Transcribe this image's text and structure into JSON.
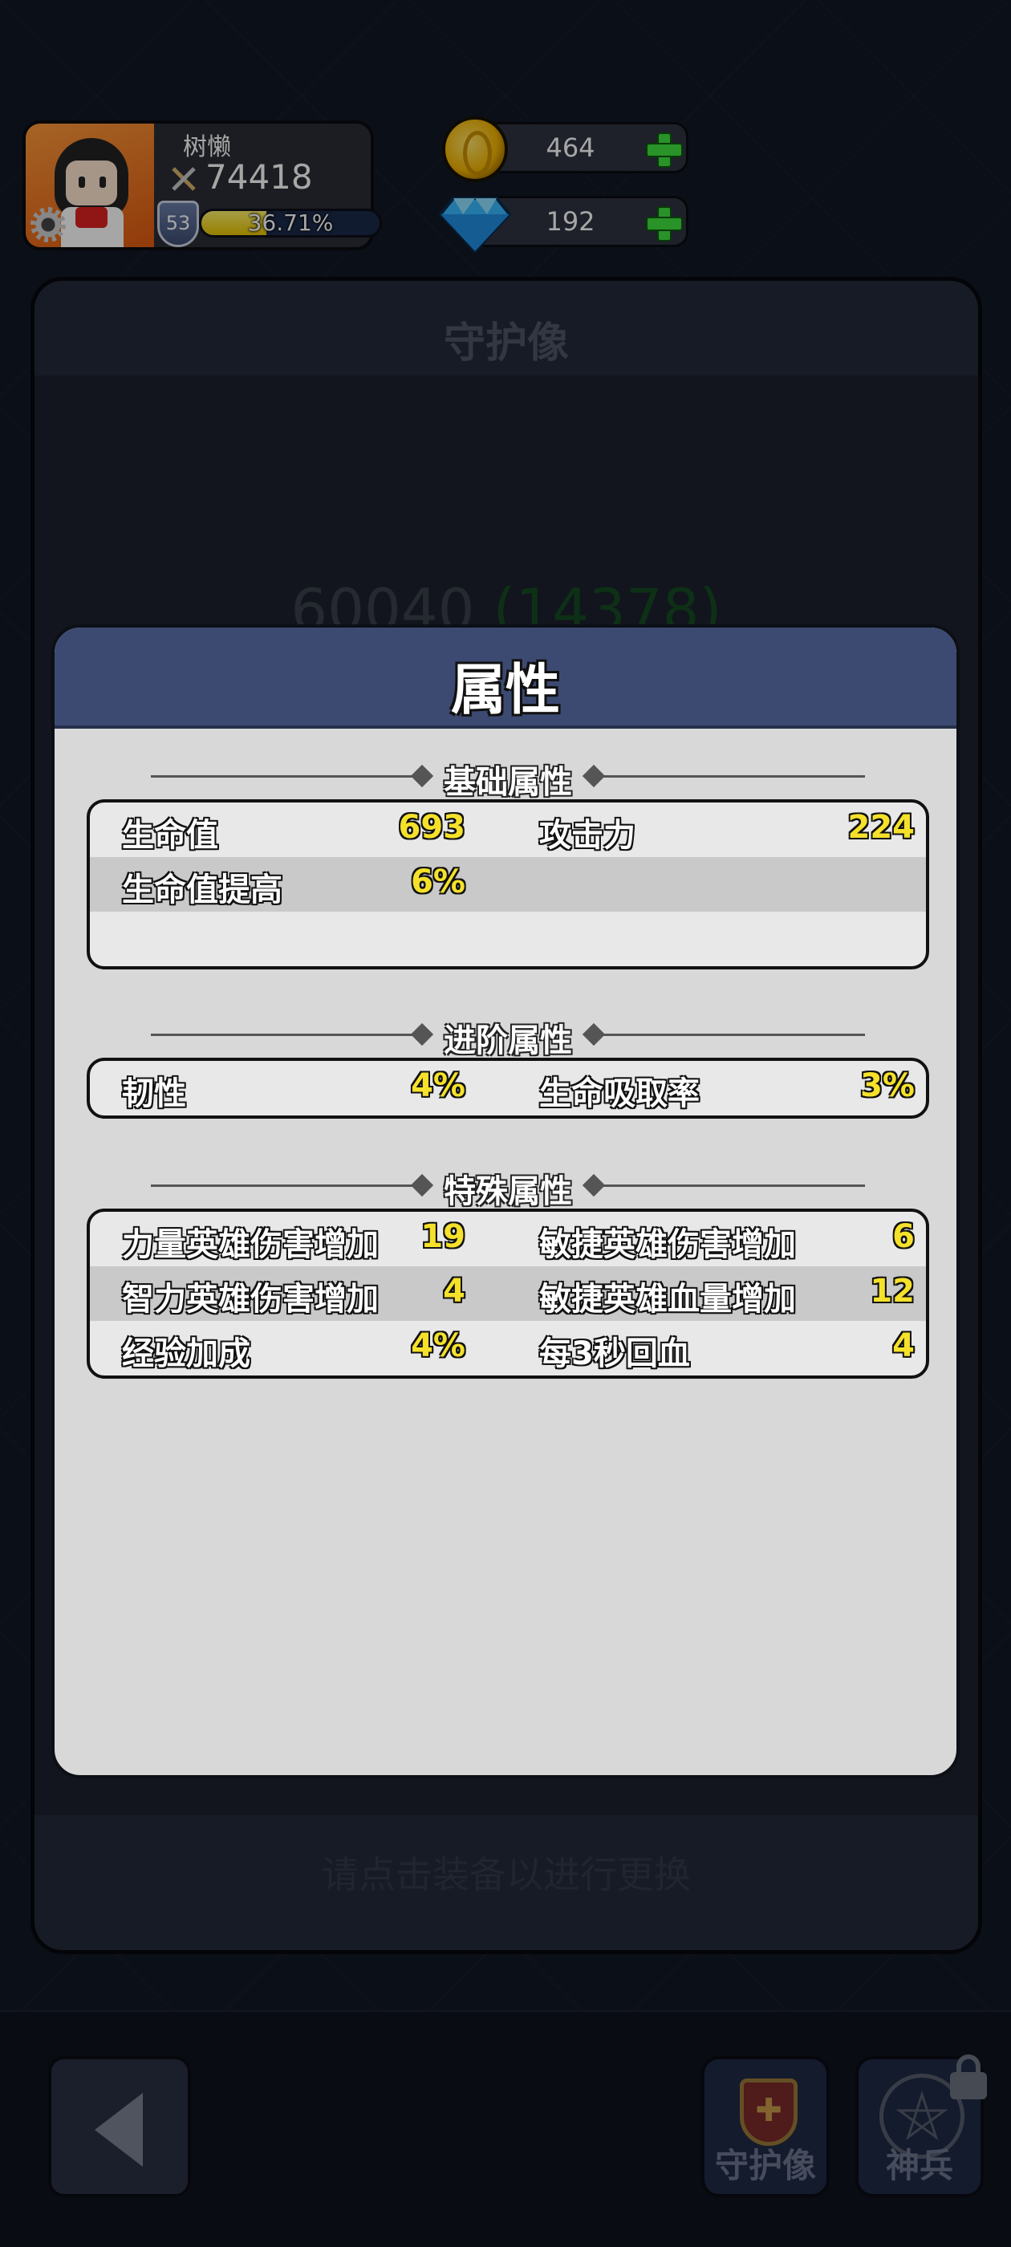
{
  "player": {
    "name": "树懒",
    "power": "74418",
    "level": "53",
    "exp_percent_text": "36.71%",
    "exp_fraction": 0.3671
  },
  "currency": {
    "gold": "464",
    "gems": "192"
  },
  "background_panel": {
    "title": "守护像",
    "power": "60040",
    "power_bonus": "(14378)",
    "hint": "请点击装备以进行更换"
  },
  "bottom_nav": {
    "guardian_label": "守护像",
    "weapon_label": "神兵"
  },
  "modal": {
    "title": "属性",
    "sections": {
      "basic": {
        "title": "基础属性",
        "rows": [
          {
            "c1_name": "生命值",
            "c1_val": "693",
            "c2_name": "攻击力",
            "c2_val": "224"
          },
          {
            "c1_name": "生命值提高",
            "c1_val": "6%",
            "c2_name": "",
            "c2_val": ""
          }
        ]
      },
      "advanced": {
        "title": "进阶属性",
        "rows": [
          {
            "c1_name": "韧性",
            "c1_val": "4%",
            "c2_name": "生命吸取率",
            "c2_val": "3%"
          }
        ]
      },
      "special": {
        "title": "特殊属性",
        "rows": [
          {
            "c1_name": "力量英雄伤害增加",
            "c1_val": "19",
            "c2_name": "敏捷英雄伤害增加",
            "c2_val": "6"
          },
          {
            "c1_name": "智力英雄伤害增加",
            "c1_val": "4",
            "c2_name": "敏捷英雄血量增加",
            "c2_val": "12"
          },
          {
            "c1_name": "经验加成",
            "c1_val": "4%",
            "c2_name": "每3秒回血",
            "c2_val": "4"
          }
        ]
      }
    }
  },
  "colors": {
    "modal_header": "#3c4a72",
    "stat_value": "#f5e12a",
    "plus_button": "#3fe03f",
    "exp_fill": "#f0d21a"
  }
}
